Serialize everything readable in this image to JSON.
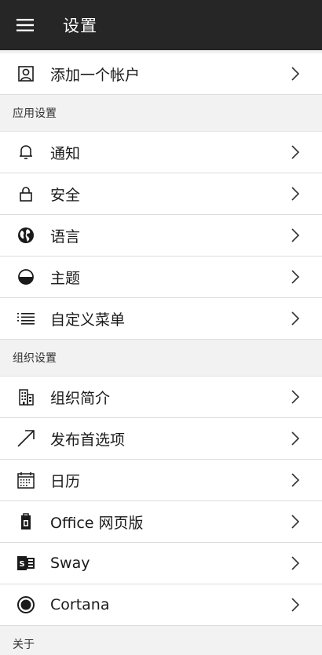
{
  "app_bar": {
    "title": "设置",
    "menu_icon": "hamburger-menu-icon"
  },
  "account": {
    "add_account_label": "添加一个帐户",
    "icon": "account-icon"
  },
  "app_settings": {
    "header": "应用设置",
    "items": [
      {
        "label": "通知",
        "icon": "bell-icon"
      },
      {
        "label": "安全",
        "icon": "lock-icon"
      },
      {
        "label": "语言",
        "icon": "globe-icon"
      },
      {
        "label": "主题",
        "icon": "theme-icon"
      },
      {
        "label": "自定义菜单",
        "icon": "list-icon"
      }
    ]
  },
  "org_settings": {
    "header": "组织设置",
    "items": [
      {
        "label": "组织简介",
        "icon": "building-icon"
      },
      {
        "label": "发布首选项",
        "icon": "arrow-diagonal-icon"
      },
      {
        "label": "日历",
        "icon": "calendar-icon"
      },
      {
        "label": "Office 网页版",
        "icon": "office-icon"
      },
      {
        "label": "Sway",
        "icon": "sway-icon"
      },
      {
        "label": "Cortana",
        "icon": "cortana-icon"
      }
    ]
  },
  "about": {
    "header": "关于"
  },
  "colors": {
    "app_bar_bg": "#262626",
    "section_bg": "#f2f2f2",
    "divider": "#dcdcdc"
  }
}
